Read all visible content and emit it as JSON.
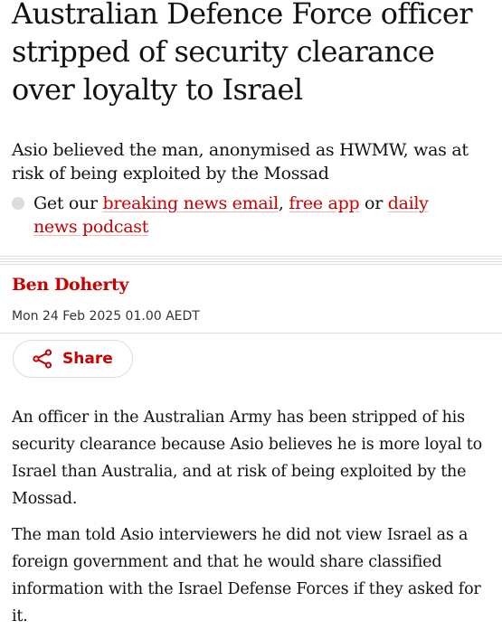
{
  "article": {
    "headline": "Australian Defence Force officer stripped of security clearance over loyalty to Israel",
    "standfirst": "Asio believed the man, anonymised as HWMW, was at risk of being exploited by the Mossad",
    "promo": {
      "prefix": "Get our ",
      "link1": "breaking news email",
      "sep1": ", ",
      "link2": "free app",
      "sep2": " or ",
      "link3_line1": "daily",
      "link3_line2": "news podcast"
    },
    "byline": "Ben Doherty",
    "dateline": "Mon 24 Feb 2025 01.00 AEDT",
    "share_label": "Share",
    "paragraphs": [
      "An officer in the Australian Army has been stripped of his security clearance because Asio believes he is more loyal to Israel than Australia, and at risk of being exploited by the Mossad.",
      "The man told Asio interviewers he did not view Israel as a foreign government and that he would share classified information with the Israel Defense Forces if they asked for it."
    ]
  },
  "icons": {
    "share": "share-icon",
    "bullet": "bullet-icon"
  },
  "colors": {
    "accent": "#c70000",
    "text": "#121212",
    "divider": "#dcdcdc"
  }
}
